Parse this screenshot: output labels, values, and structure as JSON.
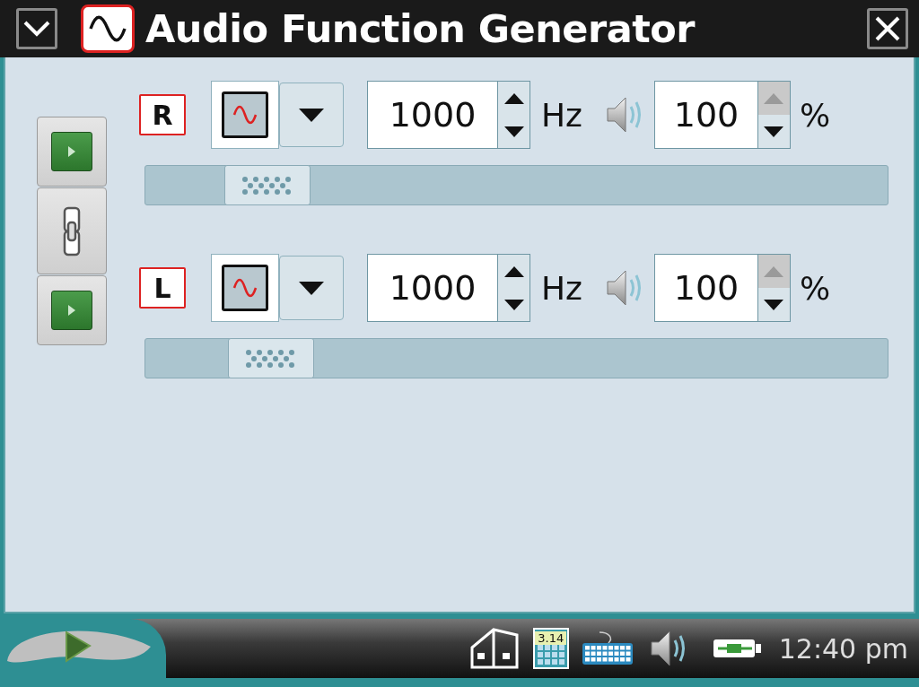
{
  "window": {
    "title": "Audio Function Generator"
  },
  "side_controls": {
    "linked": true
  },
  "channels": [
    {
      "label": "R",
      "frequency": "1000",
      "frequency_unit": "Hz",
      "volume": "100",
      "volume_unit": "%",
      "volume_up_disabled": true,
      "level": 0.12
    },
    {
      "label": "L",
      "frequency": "1000",
      "frequency_unit": "Hz",
      "volume": "100",
      "volume_unit": "%",
      "volume_up_disabled": true,
      "level": 0.125
    }
  ],
  "taskbar": {
    "calculator_text": "3.14",
    "clock": "12:40 pm"
  }
}
